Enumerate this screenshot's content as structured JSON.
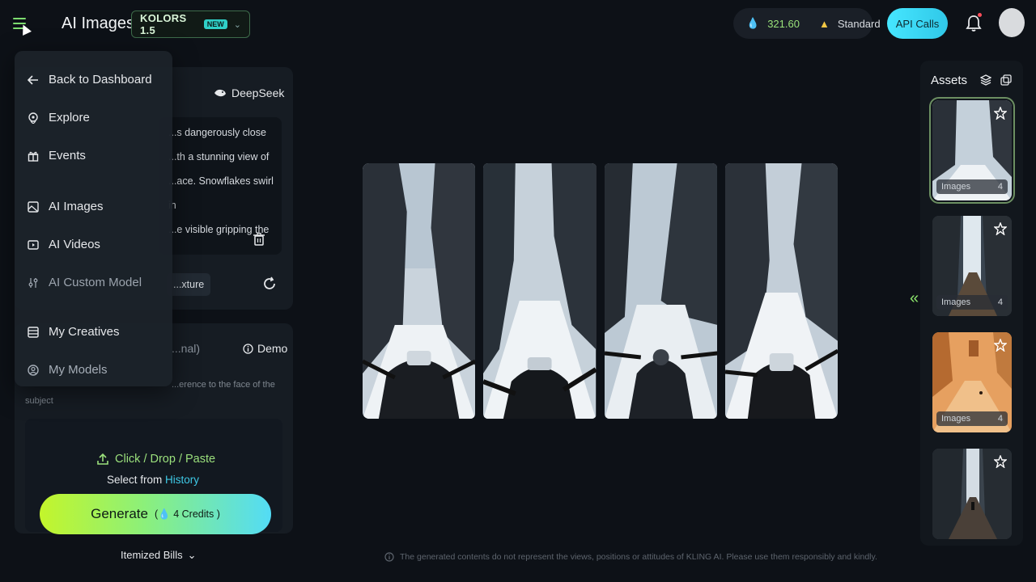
{
  "header": {
    "title": "AI Images",
    "model": {
      "name": "KOLORS 1.5",
      "badge": "NEW"
    },
    "credits": {
      "value": "321.60",
      "plan": "Standard"
    },
    "api_label": "API Calls"
  },
  "nav_menu": {
    "items": [
      {
        "label": "Back to Dashboard",
        "icon": "arrow-left-icon"
      },
      {
        "label": "Explore",
        "icon": "compass-icon"
      },
      {
        "label": "Events",
        "icon": "gift-icon"
      },
      {
        "label": "AI Images",
        "icon": "image-icon"
      },
      {
        "label": "AI Videos",
        "icon": "video-icon"
      },
      {
        "label": "AI Custom Model",
        "icon": "sliders-icon"
      },
      {
        "label": "My Creatives",
        "icon": "folder-icon"
      },
      {
        "label": "My Models",
        "icon": "face-icon"
      }
    ]
  },
  "prompt": {
    "deepseek_label": "DeepSeek",
    "text_lines": [
      "...s dangerously close",
      "...th a stunning view of",
      "...ace. Snowflakes swirl in",
      "...e visible gripping the"
    ],
    "texture_chip": "...xture"
  },
  "reference": {
    "optional_label": "...nal)",
    "demo_label": "Demo",
    "hint": "...erence to the face of the",
    "subject": "subject",
    "upload_label": "Click / Drop / Paste",
    "select_from": "Select from",
    "history_link": "History"
  },
  "generate": {
    "label": "Generate",
    "cost": "4 Credits"
  },
  "itemized_label": "Itemized Bills",
  "disclaimer": "The generated contents do not represent the views, positions or attitudes of KLING AI. Please use them responsibly and kindly.",
  "assets": {
    "title": "Assets",
    "items": [
      {
        "type": "Images",
        "count": "4",
        "selected": true
      },
      {
        "type": "Images",
        "count": "4",
        "selected": false
      },
      {
        "type": "Images",
        "count": "4",
        "selected": false
      },
      {
        "type": "",
        "count": "",
        "selected": false
      }
    ]
  },
  "colors": {
    "accent_green": "#9be07c",
    "accent_cyan": "#3ec9e6",
    "background": "#0d1117"
  }
}
